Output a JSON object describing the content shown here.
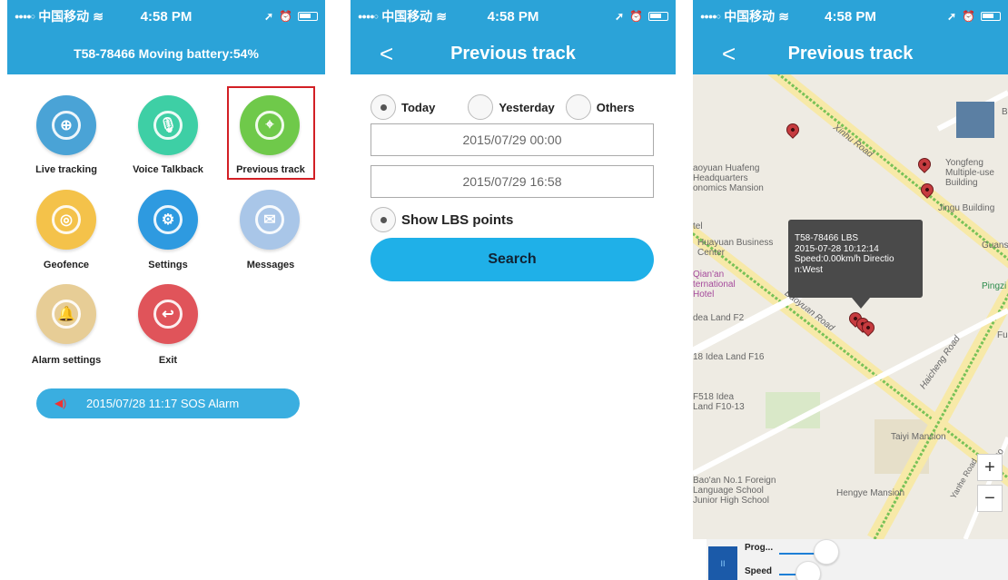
{
  "status_bar": {
    "carrier": "中国移动",
    "time": "4:58 PM"
  },
  "screen1": {
    "title": "T58-78466 Moving battery:54%",
    "menu": [
      {
        "label": "Live tracking",
        "icon": "crosshair-icon",
        "color": "#4aa3d6"
      },
      {
        "label": "Voice Talkback",
        "icon": "microphone-icon",
        "color": "#3ecfa5"
      },
      {
        "label": "Previous track",
        "icon": "map-pin-icon",
        "color": "#6fc94a"
      },
      {
        "label": "Geofence",
        "icon": "target-icon",
        "color": "#f4c24a"
      },
      {
        "label": "Settings",
        "icon": "gear-icon",
        "color": "#2e9ae0"
      },
      {
        "label": "Messages",
        "icon": "envelope-icon",
        "color": "#a9c6e8"
      },
      {
        "label": "Alarm settings",
        "icon": "bell-icon",
        "color": "#e7cd96"
      },
      {
        "label": "Exit",
        "icon": "exit-icon",
        "color": "#e0545a"
      }
    ],
    "sos_text": "2015/07/28 11:17 SOS Alarm"
  },
  "screen2": {
    "title": "Previous track",
    "back": "<",
    "options": [
      "Today",
      "Yesterday",
      "Others"
    ],
    "selected_option": "Today",
    "start_date": "2015/07/29 00:00",
    "end_date": "2015/07/29 16:58",
    "lbs_label": "Show LBS points",
    "search_label": "Search"
  },
  "screen3": {
    "title": "Previous track",
    "back": "<",
    "map_labels": {
      "xinhu": "Xinhu Road",
      "baoyuan_road": "Baoyuan Road",
      "haicheng": "Haicheng Road",
      "yanhe": "Yanhe Road",
      "huafeng": "aoyuan Huafeng Headquarters onomics Mansion",
      "yongfeng": "Yongfeng Multiple-use Building",
      "jingu": "Jingu Building",
      "tel": "tel",
      "huayuan": "Huayuan Business Center",
      "qianan": "Qian'an ternational Hotel",
      "idea_f2": "dea Land F2",
      "idea_f16": "18 Idea Land F16",
      "f518": "F518 Idea Land F10-13",
      "taiyi": "Taiyi Mansion",
      "baoan": "Bao'an No.1 Foreign Language School Junior High School",
      "hengye": "Hengye Mansion",
      "guansh": "Guansh",
      "pingzi": "Pingzi",
      "fu": "Fu",
      "bao": "Bao",
      "b": "B"
    },
    "info_popup": {
      "line1": "T58-78466  LBS",
      "line2": "2015-07-28 10:12:14",
      "line3": "Speed:0.00km/h Directio",
      "line4": "n:West"
    },
    "zoom_in": "+",
    "zoom_out": "−",
    "progress_label": "Prog...",
    "speed_label": "Speed",
    "pause_symbol": "II"
  },
  "colors": {
    "primary": "#2ba3d8",
    "search": "#1fb0e8",
    "highlight": "#d21f25"
  }
}
